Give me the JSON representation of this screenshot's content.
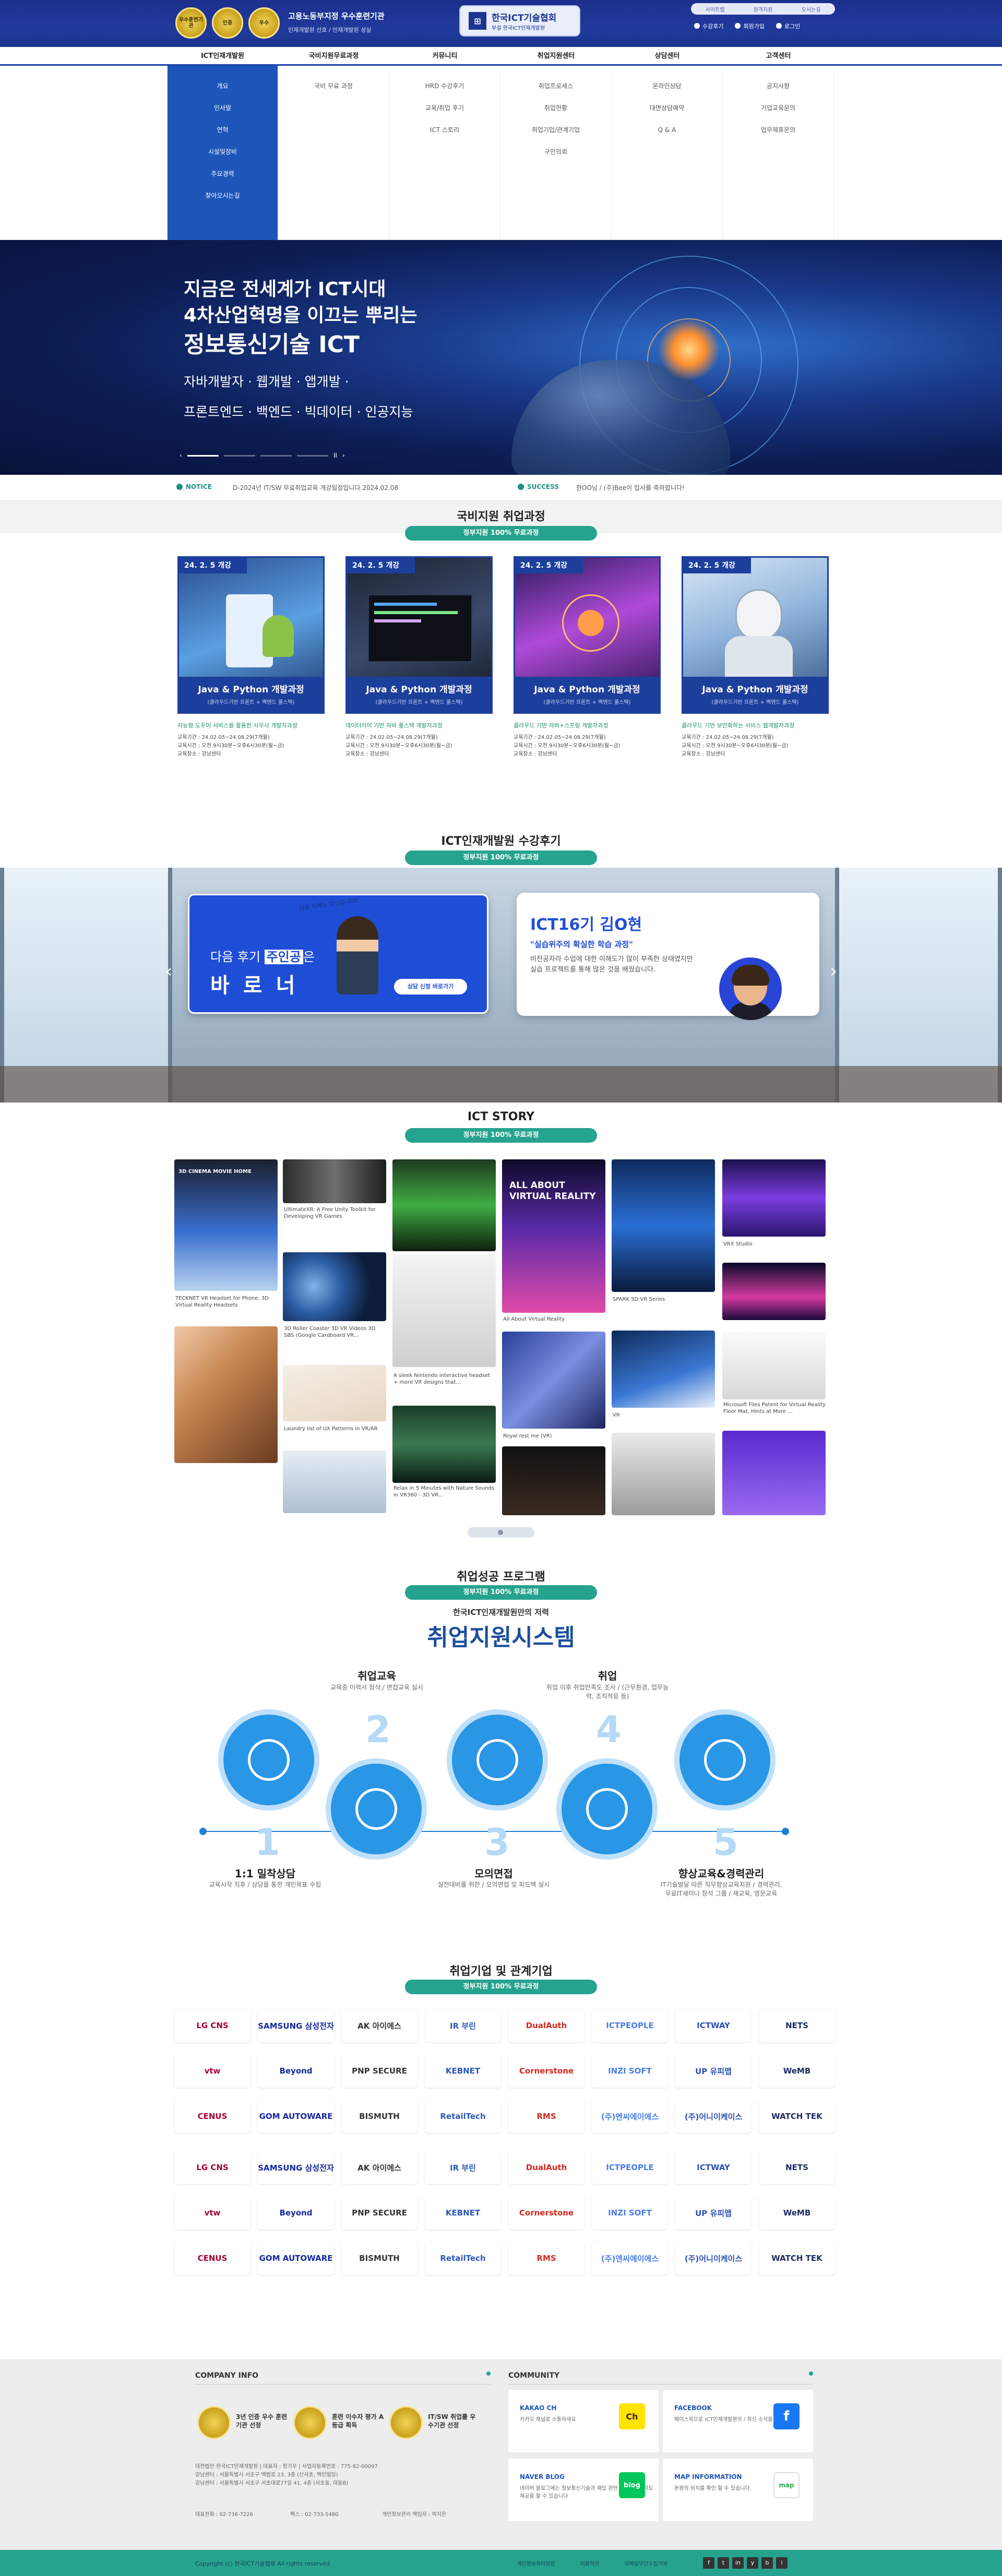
{
  "header": {
    "badges": [
      "우수훈련기관",
      "인증",
      "우수"
    ],
    "tagline1": "고용노동부지정 우수훈련기관",
    "tagline2": "인재개발원 선호 / 인재개발원 성실",
    "logo_title": "한국ICT기술협회",
    "logo_sub": "부설 한국ICT인재개발원",
    "util_top": [
      "사이트맵",
      "원격지원",
      "오시는길"
    ],
    "util_bottom": [
      "수강후기",
      "회원가입",
      "로그인"
    ]
  },
  "nav": {
    "items": [
      "ICT인재개발원",
      "국비지원무료과정",
      "커뮤니티",
      "취업지원센터",
      "상담센터",
      "고객센터"
    ],
    "mega": [
      [
        "개요",
        "인사말",
        "연혁",
        "시설및장비",
        "주요경력",
        "찾아오시는길"
      ],
      [
        "국비 무료 과정"
      ],
      [
        "HRD 수강후기",
        "교육/취업 후기",
        "ICT 스토리"
      ],
      [
        "취업프로세스",
        "취업현황",
        "취업기업/관계기업",
        "구인의뢰"
      ],
      [
        "온라인상담",
        "대면상담예약",
        "Q & A"
      ],
      [
        "공지사항",
        "기업교육문의",
        "업무제휴문의"
      ]
    ]
  },
  "hero": {
    "line1": "지금은 전세계가 ICT시대",
    "line2": "4차산업혁명을 이끄는 뿌리는",
    "line3": "정보통신기술 ICT",
    "sub1": "자바개발자 · 웹개발 · 앱개발 ·",
    "sub2": "프론트엔드 · 백엔드 · 빅데이터 · 인공지능",
    "pause": "II"
  },
  "notice": {
    "label": "NOTICE",
    "text": "D-2024년 IT/SW 무료취업교육 개강일정입니다.2024.02.08",
    "label2": "SUCCESS",
    "text2": "한OO님 / (주)Bee이 입사를 축하합니다!"
  },
  "courses_section": {
    "title": "국비지원 취업과정",
    "pill": "정부지원 100% 무료과정",
    "items": [
      {
        "tag": "24. 2. 5 개강",
        "name": "Java & Python 개발과정",
        "sub": "(클라우드기반 프론트 + 백엔드 풀스택)",
        "desc": "자능형 도우미 서비스를 활용한 사무사 개발자과정",
        "info1": "교육기간 : 24.02.05~24.08.29(7개월)",
        "info2": "교육시간 : 오전 9시30분~오후6시30분(월~금)",
        "info3": "교육장소 : 강남센터"
      },
      {
        "tag": "24. 2. 5 개강",
        "name": "Java & Python 개발과정",
        "sub": "(클라우드기반 프론트 + 백엔드 풀스택)",
        "desc": "데이터이어 기반 자바 풀스택 개발자과정",
        "info1": "교육기간 : 24.02.05~24.08.29(7개월)",
        "info2": "교육시간 : 오전 9시30분~오후6시30분(월~금)",
        "info3": "교육장소 : 강남센터"
      },
      {
        "tag": "24. 2. 5 개강",
        "name": "Java & Python 개발과정",
        "sub": "(클라우드기반 프론트 + 백엔드 풀스택)",
        "desc": "클라우드 기반 자바+스프링 개발자과정",
        "info1": "교육기간 : 24.02.05~24.08.29(7개월)",
        "info2": "교육시간 : 오전 9시30분~오후6시30분(월~금)",
        "info3": "교육장소 : 강남센터"
      },
      {
        "tag": "24. 2. 5 개강",
        "name": "Java & Python 개발과정",
        "sub": "(클라우드기반 프론트 + 백엔드 풀스택)",
        "desc": "클라우드 기반 보안화하는 서비스 웹개발자과정",
        "info1": "교육기간 : 24.02.05~24.08.29(7개월)",
        "info2": "교육시간 : 오전 9시30분~오후6시30분(월~금)",
        "info3": "교육장소 : 강남센터"
      }
    ]
  },
  "review_section": {
    "title": "ICT인재개발원 수강후기",
    "pill": "정부지원 100% 무료과정",
    "left_line1_pre": "다음 후기 ",
    "left_line1_em": "주인공",
    "left_line1_post": "은",
    "left_line2": "바로너",
    "left_button": "상담 신청 바로가기",
    "handwriting": "다음 차례는 당신입니다!",
    "right_title": "ICT16기 김O현",
    "right_quote": "\"실습위주의 확실한 학습 과정\"",
    "right_body1": "비전공자라 수업에 대한 이해도가 많이 부족한 상태였지만",
    "right_body2": "실습 프로젝트를 통해 많은 것을 배웠습니다."
  },
  "story_section": {
    "title": "ICT STORY",
    "pill": "정부지원 100% 무료과정",
    "captions": [
      "TECKNET VR Headset for Phone, 3D Virtual Reality Headsets",
      "UltimateXR: A Free Unity Toolkit for Developing VR Games",
      "3D Roller Coaster 3D VR Videos 3D SBS (Google Cardboard VR...",
      "A sleek Nintendo interactive headset + more VR designs that...",
      "Laundry list of UX Patterns in VR/AR",
      "Relax in 5 Minutes with Nature Sounds in VR360 - 3D VR...",
      "All About Virtual Reality",
      "SPARK 5D VR Series",
      "Royal rest me (VR)",
      "VR",
      "VRX Studio",
      "Microsoft Files Patent for Virtual Reality Floor Mat, Hints at More ..."
    ],
    "overlay_left": "3D CINEMA MOVIE HOME",
    "overlay_mid": "ALL ABOUT VIRTUAL REALITY"
  },
  "program_section": {
    "title": "취업성공 프로그램",
    "pill": "정부지원 100% 무료과정",
    "subtitle": "한국ICT인재개발원만의 저력",
    "big_title": "취업지원시스템",
    "steps": [
      {
        "num": "1",
        "title": "1:1 밀착상담",
        "desc": "교육시작 직후 / 상담을 통한 개인목표 수립"
      },
      {
        "num": "2",
        "title": "취업교육",
        "desc": "교육중 이력서 첨삭,/ 면접교육 실시"
      },
      {
        "num": "3",
        "title": "모의면접",
        "desc": "실전대비를 위한 / 모의면접 및 피드백 실시"
      },
      {
        "num": "4",
        "title": "취업",
        "desc": "취업 이후 취업만족도 조사 / (근무환경, 업무능력, 조직적응 등)"
      },
      {
        "num": "5",
        "title": "향상교육&경력관리",
        "desc": "IT기술발달 따른 직무향상교육지원 / 경력관리, 무료IT세미나 참석 그룹 / 재교육, 영문교육"
      }
    ]
  },
  "companies_section": {
    "title": "취업기업 및 관계기업",
    "pill": "정부지원 100% 무료과정",
    "rows": [
      [
        "LG CNS",
        "SAMSUNG 삼성전자",
        "AK 아이에스",
        "IR 부린",
        "DualAuth",
        "ICTPEOPLE",
        "ICTWAY",
        "NETS"
      ],
      [
        "vtw",
        "Beyond",
        "PNP SECURE",
        "KEBNET",
        "Cornerstone",
        "INZI SOFT",
        "UP 유피맵",
        "WeMB"
      ],
      [
        "CENUS",
        "GOM AUTOWARE",
        "BISMUTH",
        "RetailTech",
        "RMS",
        "(주)엔씨에이에스",
        "(주)어니이케이스",
        "WATCH TEK"
      ],
      [
        "LG CNS",
        "SAMSUNG 삼성전자",
        "AK 아이에스",
        "IR 부린",
        "DualAuth",
        "ICTPEOPLE",
        "ICTWAY",
        "NETS"
      ],
      [
        "vtw",
        "Beyond",
        "PNP SECURE",
        "KEBNET",
        "Cornerstone",
        "INZI SOFT",
        "UP 유피맵",
        "WeMB"
      ],
      [
        "CENUS",
        "GOM AUTOWARE",
        "BISMUTH",
        "RetailTech",
        "RMS",
        "(주)엔씨에이에스",
        "(주)어니이케이스",
        "WATCH TEK"
      ]
    ],
    "colors": [
      "#a50034",
      "#1428a0",
      "#333333",
      "#2b58b8",
      "#d7261e",
      "#4b7de8",
      "#2d4fb5",
      "#1d2b63"
    ]
  },
  "footer": {
    "company_title": "COMPANY INFO",
    "community_title": "COMMUNITY",
    "certs": [
      "3년 인증 우수 훈련기관 선정",
      "훈련 이수자 평가 A등급 획득",
      "IT/SW 취업률 우수기관 선정"
    ],
    "address_lines": [
      "대전법인 한국ICT인재개발원 | 대표자 : 정기우 | 사업자등록번호 : 775-82-00097",
      "강남센터 : 서울특별시 서초구 백범로 23, 3층 (신서초, 백인빌딩)",
      "강남센터 : 서울특별시 서초구 서초대로77길 41, 4층 (서초동, 대동B)"
    ],
    "tel": "대표전화 : 02-736-7226",
    "fax": "팩스 : 02-733-5480",
    "privacy_officer": "개인정보관리 책임자 : 박지은",
    "community": [
      {
        "title": "KAKAO CH",
        "desc": "카카오 채널로 소통하세요",
        "icon": "Ch"
      },
      {
        "title": "FACEBOOK",
        "desc": "페이스북으로 ICT인재개발원의 / 최신 소식을 받아보세요",
        "icon": "f"
      },
      {
        "title": "NAVER BLOG",
        "desc": "네이버 블로그에는 정보통신기술과 재밌 관련 / 정보를 다각도 제공을 할 수 있습니다",
        "icon": "blog"
      },
      {
        "title": "MAP INFORMATION",
        "desc": "본원의 위치를 확인 할 수 있습니다.",
        "icon": "map"
      }
    ],
    "copyright": "Copyright (c) 한국ICT기술협회 All rights reserved.",
    "links": [
      "개인정보처리방침",
      "이용약관",
      "이메일무단수집거부"
    ],
    "sns": [
      "f",
      "t",
      "in",
      "y",
      "b",
      "i"
    ]
  }
}
